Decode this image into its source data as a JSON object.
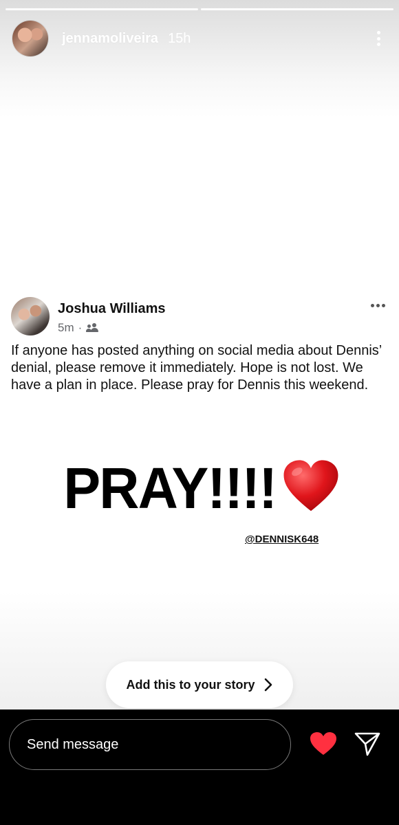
{
  "story": {
    "username": "jennamoliveira",
    "time_ago": "15h",
    "progress_segments": 2,
    "current_segment": 2
  },
  "post": {
    "author": "Joshua Williams",
    "time_ago": "5m",
    "separator": "·",
    "audience_icon": "friends-icon",
    "text": "If anyone has posted anything on social media about Dennis’ denial, please remove it immediately. Hope is not lost. We have a plan in place. Please pray for Dennis this weekend."
  },
  "sticker": {
    "text": "PRAY!!!!",
    "emoji_icon": "red-heart-icon",
    "mention": "@DENNISK648"
  },
  "add_to_story": {
    "label": "Add this to your story",
    "icon": "chevron-right-icon"
  },
  "footer": {
    "message_placeholder": "Send message",
    "like_icon": "heart-icon",
    "share_icon": "send-icon",
    "like_color": "#ff3040"
  }
}
